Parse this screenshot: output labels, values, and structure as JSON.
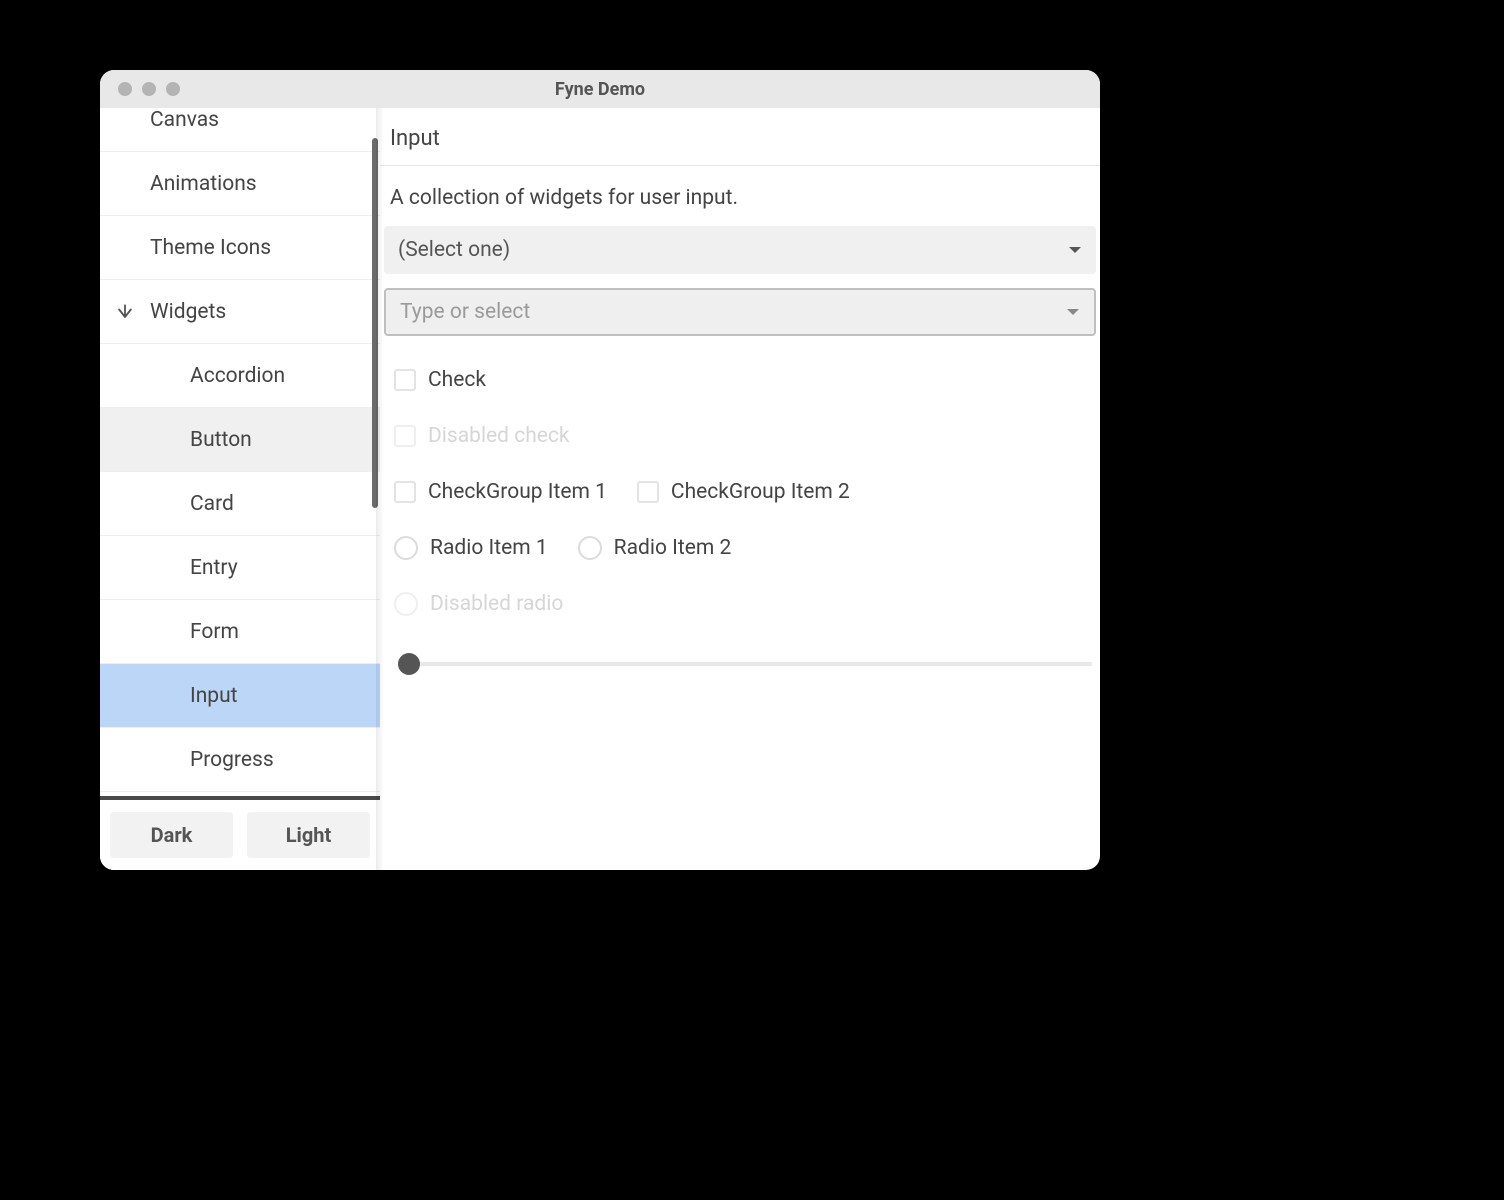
{
  "window": {
    "title": "Fyne Demo"
  },
  "sidebar": {
    "items": [
      {
        "label": "Canvas",
        "child": false
      },
      {
        "label": "Animations",
        "child": false
      },
      {
        "label": "Theme Icons",
        "child": false
      },
      {
        "label": "Widgets",
        "child": false,
        "expanded": true
      },
      {
        "label": "Accordion",
        "child": true
      },
      {
        "label": "Button",
        "child": true,
        "hover": true
      },
      {
        "label": "Card",
        "child": true
      },
      {
        "label": "Entry",
        "child": true
      },
      {
        "label": "Form",
        "child": true
      },
      {
        "label": "Input",
        "child": true,
        "selected": true
      },
      {
        "label": "Progress",
        "child": true
      }
    ],
    "theme": {
      "dark": "Dark",
      "light": "Light"
    }
  },
  "main": {
    "title": "Input",
    "desc": "A collection of widgets for user input.",
    "select_placeholder": "(Select one)",
    "combo_placeholder": "Type or select",
    "check_label": "Check",
    "disabled_check_label": "Disabled check",
    "checkgroup": [
      "CheckGroup Item 1",
      "CheckGroup Item 2"
    ],
    "radios": [
      "Radio Item 1",
      "Radio Item 2"
    ],
    "disabled_radio_label": "Disabled radio"
  }
}
